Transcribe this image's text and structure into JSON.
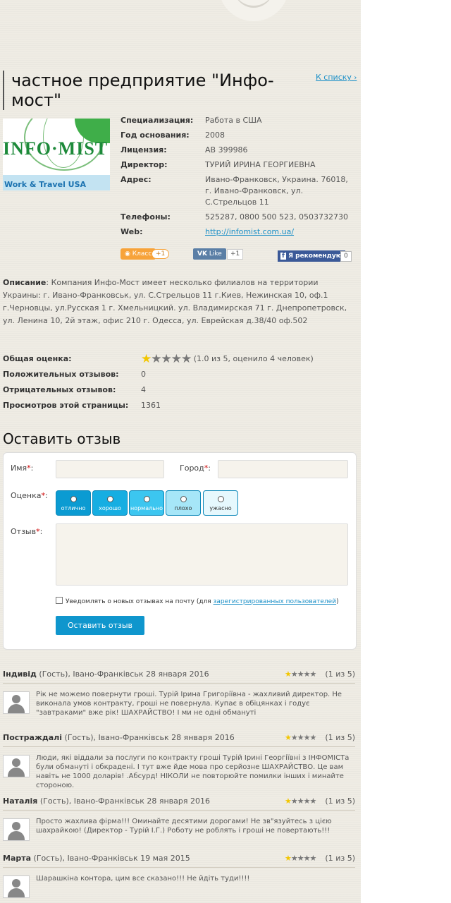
{
  "company": {
    "title": "частное предприятие \"Инфо-мост\"",
    "back_label": "К списку",
    "logo_text": "INFO·MIST",
    "logo_tagline": "Work & Travel USA"
  },
  "info": {
    "rows": [
      {
        "label": "Специализация:",
        "value": "Работа в США"
      },
      {
        "label": "Год основания:",
        "value": "2008"
      },
      {
        "label": "Лицензия:",
        "value": "АВ 399986"
      },
      {
        "label": "Директор:",
        "value": "ТУРИЙ ИРИНА ГЕОРГИЕВНА"
      },
      {
        "label": "Адрес:",
        "value": "Ивано-Франковск, Украина. 76018, г. Ивано-Франковск, ул. С.Стрельцов 11"
      },
      {
        "label": "Телефоны:",
        "value": "525287, 0800 500 523, 0503732730"
      }
    ],
    "web_label": "Web:",
    "web_url": "http://infomist.com.ua/"
  },
  "social": {
    "ok_label": "Класс",
    "ok_count": "+1",
    "vk_label": "Like",
    "vk_count": "+1",
    "fb_label": "Я рекомендую",
    "fb_count": "0"
  },
  "description": {
    "label": "Описание",
    "text": ": Компания Инфо-Мост имеет несколько филиалов на территории Украины: г. Ивано-Франковськ, ул. С.Стрельцов 11 г.Киев, Нежинская 10, оф.1 г.Черновцы, ул.Русская 1 г. Хмельницкий. ул. Владимирская 71 г. Днепропетровск, ул. Ленина 10, 2й этаж, офис 210 г. Одесса, ул. Еврейская д.38/40 оф.502"
  },
  "stats": {
    "overall_label": "Общая оценка:",
    "overall_rating": 1,
    "overall_text": "(1.0 из 5, оценило 4 человек)",
    "positive_label": "Положительных отзывов:",
    "positive_value": "0",
    "negative_label": "Отрицательных отзывов:",
    "negative_value": "4",
    "views_label": "Просмотров этой страницы:",
    "views_value": "1361"
  },
  "form": {
    "title": "Оставить отзыв",
    "name_label": "Имя",
    "city_label": "Город",
    "rating_label": "Оценка",
    "review_label": "Отзыв",
    "ratings": [
      {
        "label": "отлично",
        "bg": "#0b9bd2",
        "fg": "#ffffff"
      },
      {
        "label": "хорошо",
        "bg": "#16aee2",
        "fg": "#ffffff"
      },
      {
        "label": "нормально",
        "bg": "#3cc6f0",
        "fg": "#ffffff"
      },
      {
        "label": "плохо",
        "bg": "#a6e6f8",
        "fg": "#333333"
      },
      {
        "label": "ужасно",
        "bg": "#e6f8fd",
        "fg": "#333333"
      }
    ],
    "notify_text": "Уведомлять о новых отзывах на почту (для ",
    "notify_link": "зарегистрированных пользователей",
    "notify_end": ")",
    "submit_label": "Оставить отзыв"
  },
  "reviews": [
    {
      "author": "Індивід",
      "meta": " (Гость), Івано-Франківськ 28 января 2016",
      "rating": 1,
      "of": "(1 из 5)",
      "text": "Рік не можемо повернути гроші. Турій Ірина Григоріївна - жахливий директор. Не виконала умов контракту, гроші не повернула. Купає в обіцянках і годує \"завтраками\" вже рік! ШАХРАЙСТВО! І ми не одні обмануті"
    },
    {
      "author": "Постраждалі",
      "meta": " (Гость), Івано-Франківськ 28 января 2016",
      "rating": 1,
      "of": "(1 из 5)",
      "text": "Люди, які віддали за послуги по контракту гроші Турій Ірині Георгіївні з ІНФОМІСТа були обмануті і обкрадені. І тут вже йде мова про серйозне ШАХРАЙСТВО. Це вам навіть не 1000 доларів! .Абсурд! НІКОЛИ не повторюйте помилки інших і минайте стороною."
    },
    {
      "author": "Наталія",
      "meta": " (Гость), Івано-Франківськ 28 января 2016",
      "rating": 1,
      "of": "(1 из 5)",
      "text": "Просто жахлива фірма!!! Оминайте десятими дорогами! Не зв\"язуйтесь з цією шахрайкою! (Директор - Турій І.Г.) Роботу не роблять і гроші не повертають!!!"
    },
    {
      "author": "Марта",
      "meta": " (Гость), Івано-Франківськ 19 мая 2015",
      "rating": 1,
      "of": "(1 из 5)",
      "text": "Шарашкіна контора, цим все сказано!!! Не йдіть туди!!!!"
    }
  ]
}
